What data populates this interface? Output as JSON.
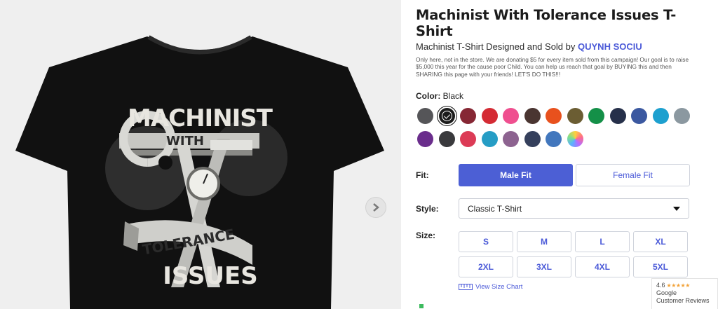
{
  "product": {
    "title": "Machinist With Tolerance Issues T-Shirt",
    "subtitle_prefix": "Machinist T-Shirt Designed and Sold by",
    "seller": "QUYNH SOCIU",
    "description": "Only here, not in the store. We are donating $5 for every item sold from this campaign! Our goal is to raise $5,000 this year for the cause poor Child. You can help us reach that goal by BUYING this and then SHARING this page with your friends! LET'S DO THIS!!!"
  },
  "artwork": {
    "line1": "MACHINIST",
    "line2": "WITH",
    "line3": "TOLERANCE",
    "line4": "ISSUES"
  },
  "color": {
    "label": "Color:",
    "selected": "Black",
    "swatches_row1": [
      "#555558",
      "#1b1b1b",
      "#862734",
      "#d42b34",
      "#ef4f8f",
      "#4a3531",
      "#e8511d",
      "#6b5d33",
      "#149048",
      "#26304a",
      "#3b58a0",
      "#1da0cf",
      "#8b98a0"
    ],
    "swatches_row2": [
      "#6a2d8c",
      "#3a3a3d",
      "#dc3b56",
      "#269dc5",
      "#8d6390",
      "#35405c",
      "#4277bd",
      "multicolor"
    ],
    "selected_index": 1
  },
  "fit": {
    "label": "Fit:",
    "options": [
      "Male Fit",
      "Female Fit"
    ],
    "selected": "Male Fit"
  },
  "style": {
    "label": "Style:",
    "value": "Classic T-Shirt"
  },
  "size": {
    "label": "Size:",
    "options": [
      "S",
      "M",
      "L",
      "XL",
      "2XL",
      "3XL",
      "4XL",
      "5XL"
    ],
    "chart_link": "View Size Chart"
  },
  "reviews": {
    "rating": "4.6",
    "stars": "★★★★★",
    "source": "Google",
    "label": "Customer Reviews"
  }
}
